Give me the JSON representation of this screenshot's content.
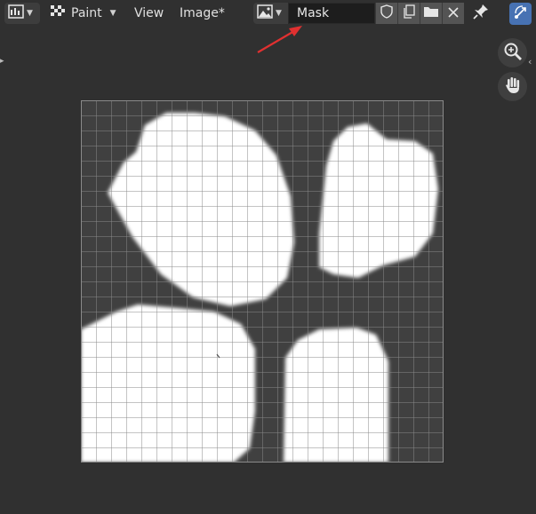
{
  "header": {
    "mode_label": "Paint",
    "menus": [
      "View",
      "Image*"
    ],
    "image_name": "Mask"
  },
  "icons": {
    "editor_type": "image-editor-icon",
    "mode": "texture-paint-icon",
    "image_browse": "image-icon",
    "fake_user": "shield-icon",
    "duplicate": "copy-icon",
    "open": "folder-icon",
    "unlink": "close-icon",
    "pin": "pin-icon",
    "gizmo": "gizmo-icon",
    "zoom": "zoom-in-icon",
    "pan": "hand-icon"
  },
  "colors": {
    "header_bg": "#303030",
    "field_bg": "#1d1d1d",
    "button_bg": "#545454",
    "accent": "#4772b3",
    "annotation_arrow": "#e03030",
    "grid_line": "#8a8a8a",
    "mask_fill": "#ffffff"
  }
}
